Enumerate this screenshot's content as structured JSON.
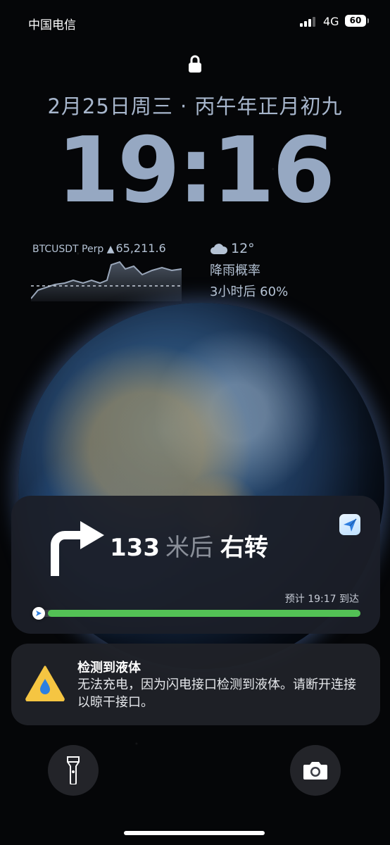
{
  "status_bar": {
    "carrier": "中国电信",
    "network": "4G",
    "battery": "60"
  },
  "lock_screen": {
    "date_line": "2月25日周三 · 丙午年正月初九",
    "time": "19:16"
  },
  "widgets": {
    "ticker": {
      "symbol": "BTCUSDT Perp",
      "direction_icon": "up-triangle",
      "price": "65,211.6"
    },
    "weather": {
      "icon": "cloud-icon",
      "temperature": "12°",
      "line1": "降雨概率",
      "line2": "3小时后 60%"
    }
  },
  "navigation": {
    "distance": "133",
    "unit": "米后",
    "instruction": "右转",
    "eta": "预计 19:17 到达",
    "progress": 0.03,
    "accent_color": "#53c155"
  },
  "notification": {
    "title": "检测到液体",
    "body": "无法充电，因为闪电接口检测到液体。请断开连接以晾干接口。"
  },
  "quick_actions": {
    "left": "flashlight-icon",
    "right": "camera-icon"
  }
}
